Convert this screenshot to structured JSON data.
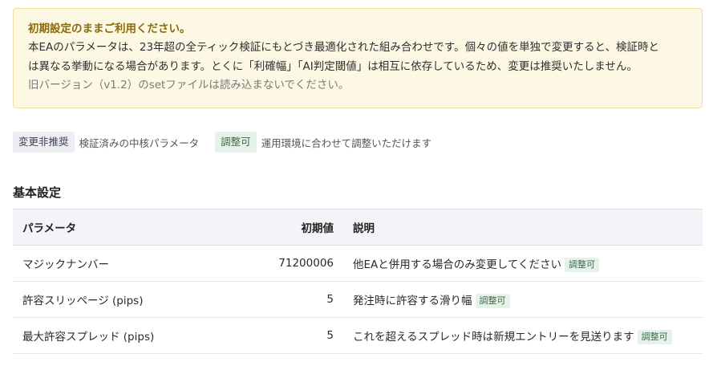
{
  "notice": {
    "title": "初期設定のままご利用ください。",
    "body_line1": "本EAのパラメータは、23年超の全ティック検証にもとづき最適化された組み合わせです。個々の値を単独で変更すると、検証時と",
    "body_line2": "は異なる挙動になる場合があります。とくに「利確幅」「AI判定閾値」は相互に依存しているため、変更は推奨いたしません。",
    "note": "旧バージョン（v1.2）のsetファイルは読み込まないでください。"
  },
  "legend": {
    "fixed_badge": "変更非推奨",
    "fixed_text": "検証済みの中核パラメータ",
    "adjustable_badge": "調整可",
    "adjustable_text": "運用環境に合わせて調整いただけます"
  },
  "section": {
    "title": "基本設定"
  },
  "table": {
    "headers": {
      "param": "パラメータ",
      "default": "初期値",
      "desc": "説明"
    },
    "rows": [
      {
        "param": "マジックナンバー",
        "default": "71200006",
        "desc": "他EAと併用する場合のみ変更してください",
        "tag": "調整可"
      },
      {
        "param": "許容スリッページ (pips)",
        "default": "5",
        "desc": "発注時に許容する滑り幅",
        "tag": "調整可"
      },
      {
        "param": "最大許容スプレッド (pips)",
        "default": "5",
        "desc": "これを超えるスプレッド時は新規エントリーを見送ります",
        "tag": "調整可"
      }
    ]
  }
}
